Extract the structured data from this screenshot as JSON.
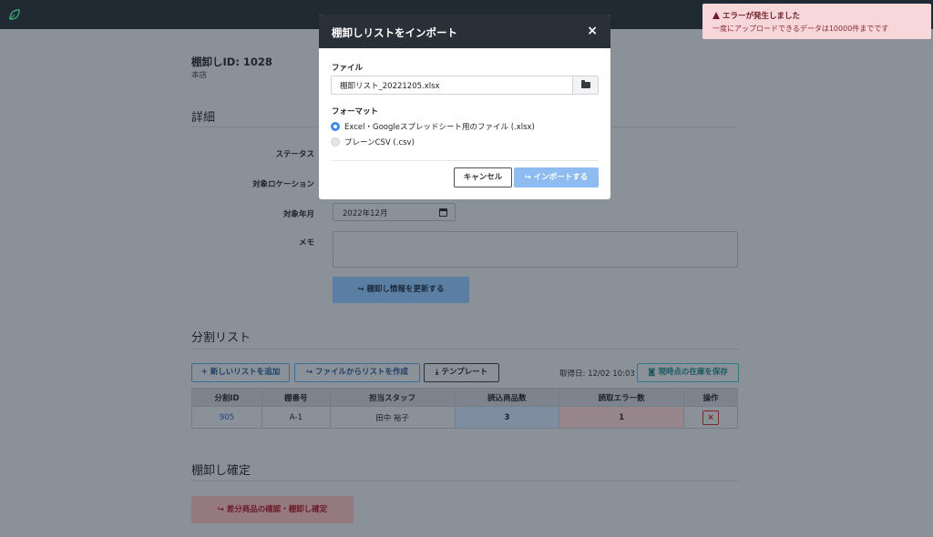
{
  "inventory": {
    "title": "棚卸しID: 1028",
    "subtitle": "本店"
  },
  "details": {
    "heading": "詳細",
    "status_label": "ステータス",
    "location_label": "対象ロケーション",
    "month_label": "対象年月",
    "month_value": "2022年12月",
    "memo_label": "メモ",
    "update_button": "↪ 棚卸し情報を更新する"
  },
  "split_list": {
    "heading": "分割リスト",
    "add_button": "+ 新しいリストを追加",
    "from_file_button": "↪ ファイルからリストを作成",
    "template_button": "⤓ テンプレート",
    "fetch_date": "取得日: 12/02 10:03",
    "save_stock_button": "◙ 現時点の在庫を保存",
    "columns": [
      "分割ID",
      "棚番号",
      "担当スタッフ",
      "読込商品数",
      "読取エラー数",
      "操作"
    ],
    "rows": [
      {
        "id": "905",
        "shelf": "A-1",
        "staff": "田中 裕子",
        "read_count": "3",
        "error_count": "1",
        "delete": "×"
      }
    ]
  },
  "confirm": {
    "heading": "棚卸し確定",
    "button": "↪ 差分商品の確認・棚卸し確定"
  },
  "modal": {
    "title": "棚卸しリストをインポート",
    "close": "×",
    "file_label": "ファイル",
    "file_value": "棚卸リスト_20221205.xlsx",
    "format_label": "フォーマット",
    "option_xlsx": "Excel・Googleスプレッドシート用のファイル (.xlsx)",
    "option_csv": "プレーンCSV (.csv)",
    "selected_format": "xlsx",
    "cancel_button": "キャンセル",
    "import_button": "↪ インポートする"
  },
  "toast": {
    "title": "エラーが発生しました",
    "message": "一度にアップロードできるデータは10000件までです"
  },
  "colors": {
    "topbar": "#1f2a33",
    "primary": "#3f8de3",
    "danger_bg": "#f8d7da",
    "danger_text": "#6c1f27"
  }
}
